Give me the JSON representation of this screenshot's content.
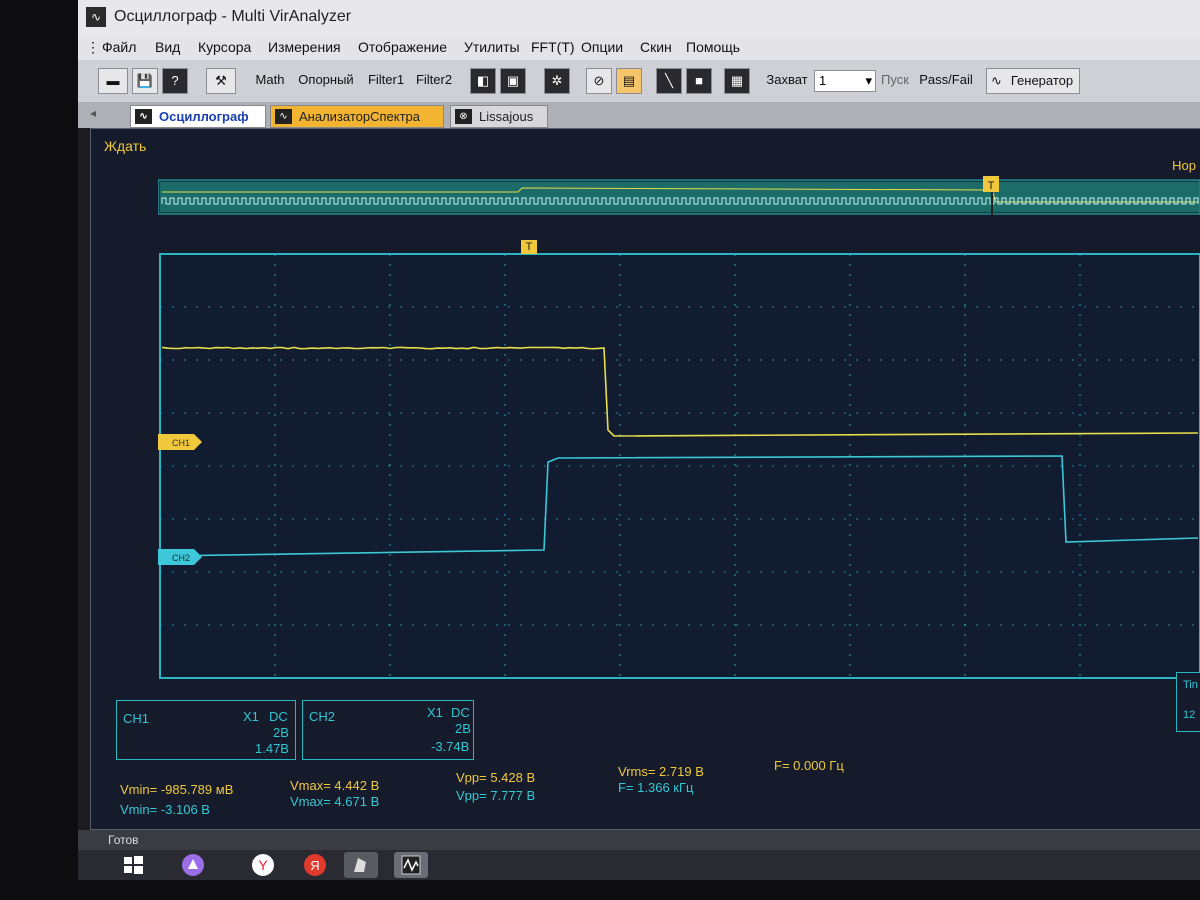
{
  "window": {
    "title": "Осциллограф - Multi VirAnalyzer"
  },
  "menu": {
    "items": [
      "Файл",
      "Вид",
      "Курсора",
      "Измерения",
      "Отображение",
      "Утилиты",
      "FFT(T)",
      "Опции",
      "Скин",
      "Помощь"
    ]
  },
  "toolbar": {
    "math_label": "Math",
    "reference_label": "Опорный",
    "filter1_label": "Filter1",
    "filter2_label": "Filter2",
    "capture_label": "Захват",
    "capture_value": "1",
    "start_label": "Пуск",
    "passfail_label": "Pass/Fail",
    "generator_label": "Генератор"
  },
  "tabs": [
    {
      "label": "Осциллограф",
      "icon": "scope-icon"
    },
    {
      "label": "АнализаторСпектра",
      "icon": "spectrum-icon"
    },
    {
      "label": "Lissajous",
      "icon": "lissajous-icon"
    }
  ],
  "scope": {
    "status": "Ждать",
    "mode": "Нор",
    "trigger_marker": "T",
    "ch1_marker": "CH1",
    "ch2_marker": "CH2",
    "time_label_partial": "Tin",
    "time_value_partial": "12"
  },
  "channels": [
    {
      "name": "CH1",
      "probe": "X1",
      "coupling": "DC",
      "volts_div": "2В",
      "offset": "1.47В"
    },
    {
      "name": "CH2",
      "probe": "X1",
      "coupling": "DC",
      "volts_div": "2В",
      "offset": "-3.74В"
    }
  ],
  "measurements": {
    "ch1": {
      "vmin": "Vmin= -985.789 мВ",
      "vmax": "Vmax= 4.442 В",
      "vpp": "Vpp= 5.428 В",
      "vrms": "Vrms= 2.719 В",
      "f": "F= 0.000 Гц"
    },
    "ch2": {
      "vmin": "Vmin= -3.106 В",
      "vmax": "Vmax= 4.671 В",
      "vpp": "Vpp= 7.777 В",
      "f": "F= 1.366 кГц"
    }
  },
  "statusbar": {
    "text": "Готов"
  },
  "colors": {
    "ch1": "#e8dd4a",
    "ch2": "#3cc8d8",
    "grid": "#2bb5c4",
    "accent": "#f0c83c"
  }
}
